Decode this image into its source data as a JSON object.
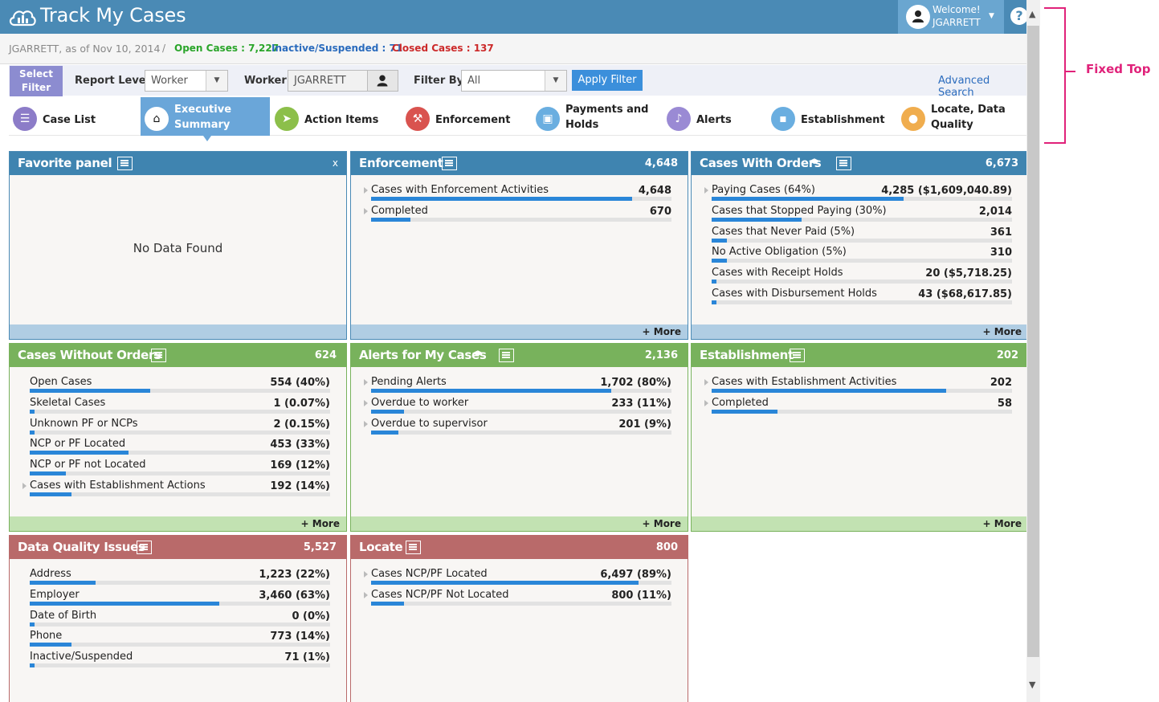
{
  "header": {
    "title": "Track My Cases",
    "welcome": "Welcome!",
    "user": "JGARRETT",
    "help": "?"
  },
  "status_line": {
    "user_date": "JGARRETT, as of Nov 10, 2014",
    "separator": "/",
    "open_cases": "Open Cases : 7,227",
    "inactive": "Inactive/Suspended : 71",
    "closed": "Closed Cases : 137"
  },
  "filter": {
    "select_filter": "Select Filter",
    "report_level_label": "Report Level",
    "report_level_value": "Worker",
    "worker_label": "Worker",
    "worker_value": "JGARRETT",
    "filter_by_label": "Filter By",
    "filter_by_value": "All",
    "apply_button": "Apply Filter",
    "advanced_search": "Advanced Search"
  },
  "nav": {
    "tabs": [
      {
        "label": "Case List",
        "icon": "list-icon",
        "color": "#8c7cc8"
      },
      {
        "label": "Executive Summary",
        "icon": "home-icon",
        "color": "#ffffff",
        "active": true
      },
      {
        "label": "Action Items",
        "icon": "send-icon",
        "color": "#8cbf4a"
      },
      {
        "label": "Enforcement",
        "icon": "gavel-icon",
        "color": "#d9534f"
      },
      {
        "label": "Payments and Holds",
        "icon": "money-icon",
        "color": "#6aaee0"
      },
      {
        "label": "Alerts",
        "icon": "bell-icon",
        "color": "#9a8ad4"
      },
      {
        "label": "Establishment",
        "icon": "briefcase-icon",
        "color": "#6aaee0"
      },
      {
        "label": "Locate, Data Quality",
        "icon": "map-pin-icon",
        "color": "#f0ad4e"
      }
    ]
  },
  "panels": {
    "favorite": {
      "title": "Favorite panel",
      "close": "x",
      "empty": "No Data Found"
    },
    "enforcement": {
      "title": "Enforcement",
      "count": "4,648",
      "more": "+ More",
      "rows": [
        {
          "label": "Cases with Enforcement Activities",
          "value": "4,648",
          "pct": 0.87
        },
        {
          "label": "Completed",
          "value": "670",
          "pct": 0.13
        }
      ]
    },
    "cases_with_orders": {
      "title": "Cases With Orders",
      "count": "6,673",
      "more": "+ More",
      "rows": [
        {
          "label": "Paying Cases (64%)",
          "value": "4,285 ($1,609,040.89)",
          "pct": 0.64
        },
        {
          "label": "Cases that Stopped Paying (30%)",
          "value": "2,014",
          "pct": 0.3
        },
        {
          "label": "Cases that Never Paid (5%)",
          "value": "361",
          "pct": 0.05
        },
        {
          "label": "No Active Obligation (5%)",
          "value": "310",
          "pct": 0.05
        },
        {
          "label": "Cases with Receipt Holds",
          "value": "20 ($5,718.25)",
          "pct": 0.003
        },
        {
          "label": "Cases with Disbursement Holds",
          "value": "43 ($68,617.85)",
          "pct": 0.007
        }
      ]
    },
    "without_orders": {
      "title": "Cases Without Orders",
      "count": "624",
      "more": "+ More",
      "rows": [
        {
          "label": "Open Cases",
          "value": "554 (40%)",
          "pct": 0.4
        },
        {
          "label": "Skeletal Cases",
          "value": "1 (0.07%)",
          "pct": 0.0007
        },
        {
          "label": "Unknown PF or NCPs",
          "value": "2 (0.15%)",
          "pct": 0.0015
        },
        {
          "label": "NCP or PF Located",
          "value": "453 (33%)",
          "pct": 0.33
        },
        {
          "label": "NCP or PF not Located",
          "value": "169 (12%)",
          "pct": 0.12
        },
        {
          "label": "Cases with Establishment Actions",
          "value": "192 (14%)",
          "pct": 0.14
        }
      ]
    },
    "alerts": {
      "title": "Alerts for My Cases",
      "count": "2,136",
      "more": "+ More",
      "rows": [
        {
          "label": "Pending Alerts",
          "value": "1,702 (80%)",
          "pct": 0.8
        },
        {
          "label": "Overdue to worker",
          "value": "233 (11%)",
          "pct": 0.11
        },
        {
          "label": "Overdue to supervisor",
          "value": "201 (9%)",
          "pct": 0.09
        }
      ]
    },
    "establishment": {
      "title": "Establishment",
      "count": "202",
      "more": "+ More",
      "rows": [
        {
          "label": "Cases with Establishment Activities",
          "value": "202",
          "pct": 0.78
        },
        {
          "label": "Completed",
          "value": "58",
          "pct": 0.22
        }
      ]
    },
    "data_quality": {
      "title": "Data Quality Issues",
      "count": "5,527",
      "rows": [
        {
          "label": "Address",
          "value": "1,223 (22%)",
          "pct": 0.22
        },
        {
          "label": "Employer",
          "value": "3,460 (63%)",
          "pct": 0.63
        },
        {
          "label": "Date of Birth",
          "value": "0 (0%)",
          "pct": 0
        },
        {
          "label": "Phone",
          "value": "773 (14%)",
          "pct": 0.14
        },
        {
          "label": "Inactive/Suspended",
          "value": "71 (1%)",
          "pct": 0.01
        }
      ]
    },
    "locate": {
      "title": "Locate",
      "count": "800",
      "rows": [
        {
          "label": "Cases NCP/PF Located",
          "value": "6,497 (89%)",
          "pct": 0.89
        },
        {
          "label": "Cases NCP/PF Not Located",
          "value": "800 (11%)",
          "pct": 0.11
        }
      ]
    }
  },
  "annotation": {
    "label": "Fixed Top"
  }
}
